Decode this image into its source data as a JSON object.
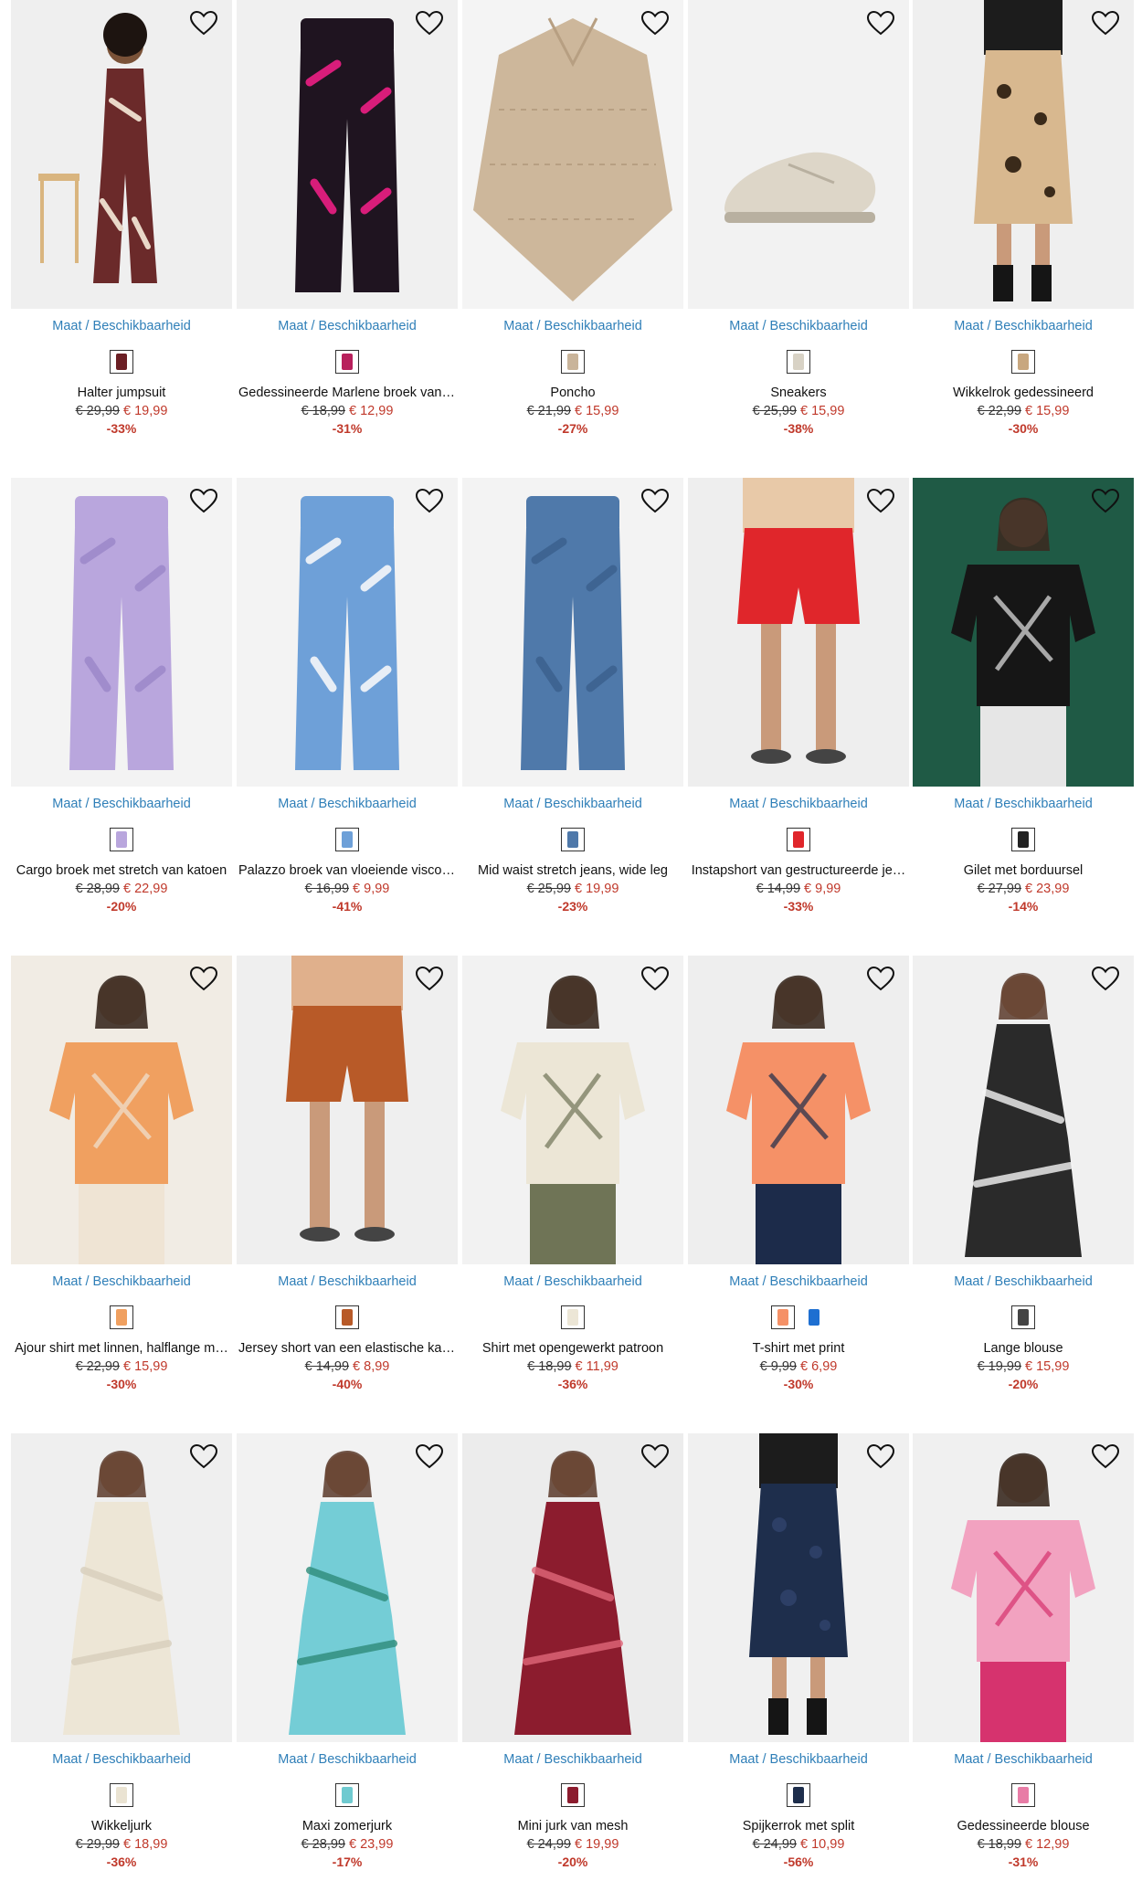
{
  "size_link_label": "Maat / Beschikbaarheid",
  "favorite_icon": "heart-outline-icon",
  "colors": {
    "link": "#2f7fb8",
    "sale": "#c0392b",
    "text": "#111111"
  },
  "products": [
    {
      "title": "Halter jumpsuit",
      "old_price": "€ 29,99",
      "new_price": "€ 19,99",
      "discount": "-33%",
      "swatches": [
        "#6b1f24"
      ],
      "bg": "#efefef",
      "garment": "#6b2a2a",
      "accent": "#e9d8c8",
      "shape": "jumpsuit"
    },
    {
      "title": "Gedessineerde Marlene broek van s…",
      "old_price": "€ 18,99",
      "new_price": "€ 12,99",
      "discount": "-31%",
      "swatches": [
        "#b8205c"
      ],
      "bg": "#f0f0f0",
      "garment": "#1f1420",
      "accent": "#d81d7a",
      "shape": "pants"
    },
    {
      "title": "Poncho",
      "old_price": "€ 21,99",
      "new_price": "€ 15,99",
      "discount": "-27%",
      "swatches": [
        "#c9b49a"
      ],
      "bg": "#f4f4f4",
      "garment": "#cdb79b",
      "accent": "#b79f82",
      "shape": "poncho"
    },
    {
      "title": "Sneakers",
      "old_price": "€ 25,99",
      "new_price": "€ 15,99",
      "discount": "-38%",
      "swatches": [
        "#d8d2c5"
      ],
      "bg": "#f2f2f2",
      "garment": "#ddd6c8",
      "accent": "#b8b0a0",
      "shape": "shoe"
    },
    {
      "title": "Wikkelrok gedessineerd",
      "old_price": "€ 22,99",
      "new_price": "€ 15,99",
      "discount": "-30%",
      "swatches": [
        "#c8a77f"
      ],
      "bg": "#efefef",
      "garment": "#d8b88f",
      "accent": "#3a2a1a",
      "shape": "skirt"
    },
    {
      "title": "Cargo broek met stretch van katoen",
      "old_price": "€ 28,99",
      "new_price": "€ 22,99",
      "discount": "-20%",
      "swatches": [
        "#b9a6dd"
      ],
      "bg": "#f3f3f3",
      "garment": "#b9a6dd",
      "accent": "#a08ccc",
      "shape": "pants"
    },
    {
      "title": "Palazzo broek van vloeiende viscos…",
      "old_price": "€ 16,99",
      "new_price": "€ 9,99",
      "discount": "-41%",
      "swatches": [
        "#6ea0d8"
      ],
      "bg": "#f3f3f3",
      "garment": "#6ea0d8",
      "accent": "#e8eef6",
      "shape": "pants"
    },
    {
      "title": "Mid waist stretch jeans, wide leg",
      "old_price": "€ 25,99",
      "new_price": "€ 19,99",
      "discount": "-23%",
      "swatches": [
        "#4f79aa"
      ],
      "bg": "#f3f3f3",
      "garment": "#4f79aa",
      "accent": "#3e6492",
      "shape": "pants"
    },
    {
      "title": "Instapshort van gestructureerde je…",
      "old_price": "€ 14,99",
      "new_price": "€ 9,99",
      "discount": "-33%",
      "swatches": [
        "#e0262b"
      ],
      "bg": "#eeeeee",
      "garment": "#e0262b",
      "accent": "#e8c9a8",
      "shape": "shorts"
    },
    {
      "title": "Gilet met borduursel",
      "old_price": "€ 27,99",
      "new_price": "€ 23,99",
      "discount": "-14%",
      "swatches": [
        "#222222"
      ],
      "bg": "#1f5a45",
      "garment": "#161616",
      "accent": "#e6e6e6",
      "shape": "top"
    },
    {
      "title": "Ajour shirt met linnen, halflange m…",
      "old_price": "€ 22,99",
      "new_price": "€ 15,99",
      "discount": "-30%",
      "swatches": [
        "#f0a060"
      ],
      "bg": "#f1ece4",
      "garment": "#f0a060",
      "accent": "#efe4d4",
      "shape": "top"
    },
    {
      "title": "Jersey short van een elastische kat…",
      "old_price": "€ 14,99",
      "new_price": "€ 8,99",
      "discount": "-40%",
      "swatches": [
        "#b85a28"
      ],
      "bg": "#efefef",
      "garment": "#b85a28",
      "accent": "#e0b08c",
      "shape": "shorts"
    },
    {
      "title": "Shirt met opengewerkt patroon",
      "old_price": "€ 18,99",
      "new_price": "€ 11,99",
      "discount": "-36%",
      "swatches": [
        "#ece6d6"
      ],
      "bg": "#f2f2f2",
      "garment": "#ece6d6",
      "accent": "#6f7456",
      "shape": "top"
    },
    {
      "title": "T-shirt met print",
      "old_price": "€ 9,99",
      "new_price": "€ 6,99",
      "discount": "-30%",
      "swatches": [
        "#f59167",
        "#1e6fd1"
      ],
      "bg": "#eeeeee",
      "garment": "#f59167",
      "accent": "#1c2b4a",
      "shape": "top"
    },
    {
      "title": "Lange blouse",
      "old_price": "€ 19,99",
      "new_price": "€ 15,99",
      "discount": "-20%",
      "swatches": [
        "#444444"
      ],
      "bg": "#f0f0f0",
      "garment": "#2a2a2a",
      "accent": "#f5f5f5",
      "shape": "dress"
    },
    {
      "title": "Wikkeljurk",
      "old_price": "€ 29,99",
      "new_price": "€ 18,99",
      "discount": "-36%",
      "swatches": [
        "#eae3d2"
      ],
      "bg": "#efefef",
      "garment": "#ede6d6",
      "accent": "#d8cfbc",
      "shape": "dress"
    },
    {
      "title": "Maxi zomerjurk",
      "old_price": "€ 28,99",
      "new_price": "€ 23,99",
      "discount": "-17%",
      "swatches": [
        "#6fcad0"
      ],
      "bg": "#f2f2f2",
      "garment": "#74cdd6",
      "accent": "#2f8c7a",
      "shape": "dress"
    },
    {
      "title": "Mini jurk van mesh",
      "old_price": "€ 24,99",
      "new_price": "€ 19,99",
      "discount": "-20%",
      "swatches": [
        "#8c1c2e"
      ],
      "bg": "#ececec",
      "garment": "#8c1c2e",
      "accent": "#e0677a",
      "shape": "dress"
    },
    {
      "title": "Spijkerrok met split",
      "old_price": "€ 24,99",
      "new_price": "€ 10,99",
      "discount": "-56%",
      "swatches": [
        "#1e2e4c"
      ],
      "bg": "#f0f0f0",
      "garment": "#1e2e4c",
      "accent": "#2d3f66",
      "shape": "skirt"
    },
    {
      "title": "Gedessineerde blouse",
      "old_price": "€ 18,99",
      "new_price": "€ 12,99",
      "discount": "-31%",
      "swatches": [
        "#e87ca6"
      ],
      "bg": "#f0f0f0",
      "garment": "#f2a2c0",
      "accent": "#d6336e",
      "shape": "top"
    }
  ]
}
